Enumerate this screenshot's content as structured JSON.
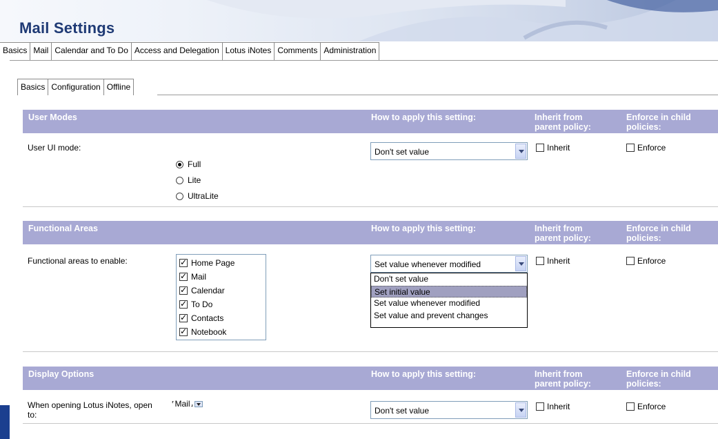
{
  "header": {
    "title": "Mail Settings"
  },
  "main_tabs": [
    {
      "label": "Basics"
    },
    {
      "label": "Mail"
    },
    {
      "label": "Calendar and To Do"
    },
    {
      "label": "Access and Delegation"
    },
    {
      "label": "Lotus iNotes"
    },
    {
      "label": "Comments"
    },
    {
      "label": "Administration"
    }
  ],
  "active_main_tab": "Lotus iNotes",
  "sub_tabs": [
    {
      "label": "Basics"
    },
    {
      "label": "Configuration"
    },
    {
      "label": "Offline"
    }
  ],
  "active_sub_tab": "Basics",
  "column_headers": {
    "how": "How to apply this setting:",
    "inherit": "Inherit from parent policy:",
    "enforce": "Enforce in child policies:"
  },
  "sections": {
    "user_modes": {
      "title": "User Modes",
      "label": "User UI mode:",
      "select_value": "Don't set value",
      "options": [
        {
          "label": "Full",
          "selected": true
        },
        {
          "label": "Lite",
          "selected": false
        },
        {
          "label": "UltraLite",
          "selected": false
        }
      ],
      "inherit_label": "Inherit",
      "enforce_label": "Enforce"
    },
    "functional_areas": {
      "title": "Functional Areas",
      "label": "Functional areas to enable:",
      "select_value": "Set value whenever modified",
      "areas": [
        {
          "label": "Home Page",
          "checked": true
        },
        {
          "label": "Mail",
          "checked": true
        },
        {
          "label": "Calendar",
          "checked": true
        },
        {
          "label": "To Do",
          "checked": true
        },
        {
          "label": "Contacts",
          "checked": true
        },
        {
          "label": "Notebook",
          "checked": true
        }
      ],
      "dropdown_options": [
        "Don't set value",
        "Set initial value",
        "Set value whenever modified",
        "Set value and prevent changes"
      ],
      "highlighted_option": "Set initial value",
      "inherit_label": "Inherit",
      "enforce_label": "Enforce"
    },
    "display_options": {
      "title": "Display Options",
      "label_line1": "When opening Lotus iNotes, open",
      "label_line2": "to:",
      "open_to_value": "Mail",
      "select_value": "Don't set value",
      "inherit_label": "Inherit",
      "enforce_label": "Enforce"
    }
  },
  "colors": {
    "title": "#1f3a75",
    "section_header_bg": "#a8a9d4",
    "section_header_text": "#ffffff",
    "left_accent": "#1b3f8f",
    "highlight": "#a0a0c0"
  }
}
